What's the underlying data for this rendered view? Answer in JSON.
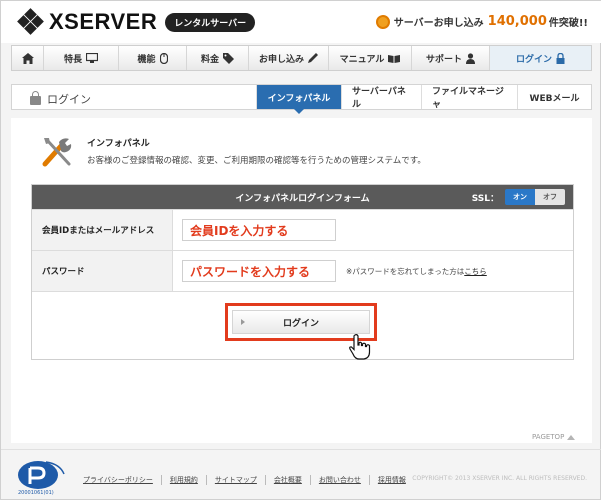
{
  "header": {
    "logo_text": "XSERVER",
    "logo_badge": "レンタルサーバー",
    "promo_prefix": "サーバーお申し込み",
    "promo_count": "140,000",
    "promo_suffix": "件突破!!"
  },
  "nav": [
    {
      "label": "",
      "icon": "home-icon"
    },
    {
      "label": "特長",
      "icon": "monitor-icon"
    },
    {
      "label": "機能",
      "icon": "mouse-icon"
    },
    {
      "label": "料金",
      "icon": "tag-icon"
    },
    {
      "label": "お申し込み",
      "icon": "pen-icon"
    },
    {
      "label": "マニュアル",
      "icon": "book-icon"
    },
    {
      "label": "サポート",
      "icon": "person-icon"
    },
    {
      "label": "ログイン",
      "icon": "lock-icon"
    }
  ],
  "subheader": {
    "title": "ログイン",
    "tabs": [
      "インフォパネル",
      "サーバーパネル",
      "ファイルマネージャ",
      "WEBメール"
    ],
    "active_tab": "インフォパネル"
  },
  "intro": {
    "title": "インフォパネル",
    "description": "お客様のご登録情報の確認、変更、ご利用期限の確認等を行うための管理システムです。"
  },
  "form": {
    "title": "インフォパネルログインフォーム",
    "ssl_label": "SSL：",
    "ssl_on": "オン",
    "ssl_off": "オフ",
    "id_label": "会員IDまたはメールアドレス",
    "id_value": "会員IDを入力する",
    "password_label": "パスワード",
    "password_value": "パスワードを入力する",
    "forgot_text": "※パスワードを忘れてしまった方は",
    "forgot_link": "こちら",
    "login_button": "ログイン"
  },
  "footer": {
    "pagetop": "PAGETOP",
    "links": [
      "プライバシーポリシー",
      "利用規約",
      "サイトマップ",
      "会社概要",
      "お問い合わせ",
      "採用情報"
    ],
    "copyright": "COPYRIGHT© 2013 XSERVER INC. ALL RIGHTS RESERVED.",
    "badge_text": "20001061(01)"
  },
  "colors": {
    "accent_blue": "#2a6db0",
    "highlight_red": "#e23b1d",
    "promo_orange": "#e07000"
  }
}
